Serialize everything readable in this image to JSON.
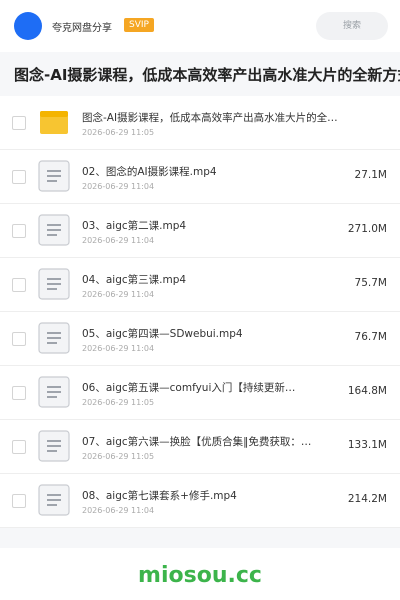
{
  "header": {
    "app_name": "夸克网盘分享",
    "badge": "SVIP",
    "search_placeholder": "搜索",
    "avatar_color": "#1e6df5"
  },
  "title": "图念-AI摄影课程，低成本高效率产出高水准大片的全新方式",
  "files": [
    {
      "name": "图念-AI摄影课程，低成本高效率产出高水准大片的全…",
      "date": "2026-06-29 11:05",
      "size": "",
      "icon": "folder-icon"
    },
    {
      "name": "02、图念的AI摄影课程.mp4",
      "date": "2026-06-29 11:04",
      "size": "27.1M",
      "icon": "video-file-icon"
    },
    {
      "name": "03、aigc第二课.mp4",
      "date": "2026-06-29 11:04",
      "size": "271.0M",
      "icon": "video-file-icon"
    },
    {
      "name": "04、aigc第三课.mp4",
      "date": "2026-06-29 11:04",
      "size": "75.7M",
      "icon": "video-file-icon"
    },
    {
      "name": "05、aigc第四课—SDwebui.mp4",
      "date": "2026-06-29 11:04",
      "size": "76.7M",
      "icon": "video-file-icon"
    },
    {
      "name": "06、aigc第五课—comfyui入门【持续更新…",
      "date": "2026-06-29 11:05",
      "size": "164.8M",
      "icon": "video-file-icon"
    },
    {
      "name": "07、aigc第六课—换脸【优质合集‖免费获取：c…",
      "date": "2026-06-29 11:05",
      "size": "133.1M",
      "icon": "video-file-icon"
    },
    {
      "name": "08、aigc第七课套系+修手.mp4",
      "date": "2026-06-29 11:04",
      "size": "214.2M",
      "icon": "video-file-icon"
    }
  ],
  "footer": {
    "watermark": "miosou.cc"
  },
  "colors": {
    "badge": "#f5a623",
    "watermark": "#3cb44b",
    "folder": "#f7c531"
  }
}
